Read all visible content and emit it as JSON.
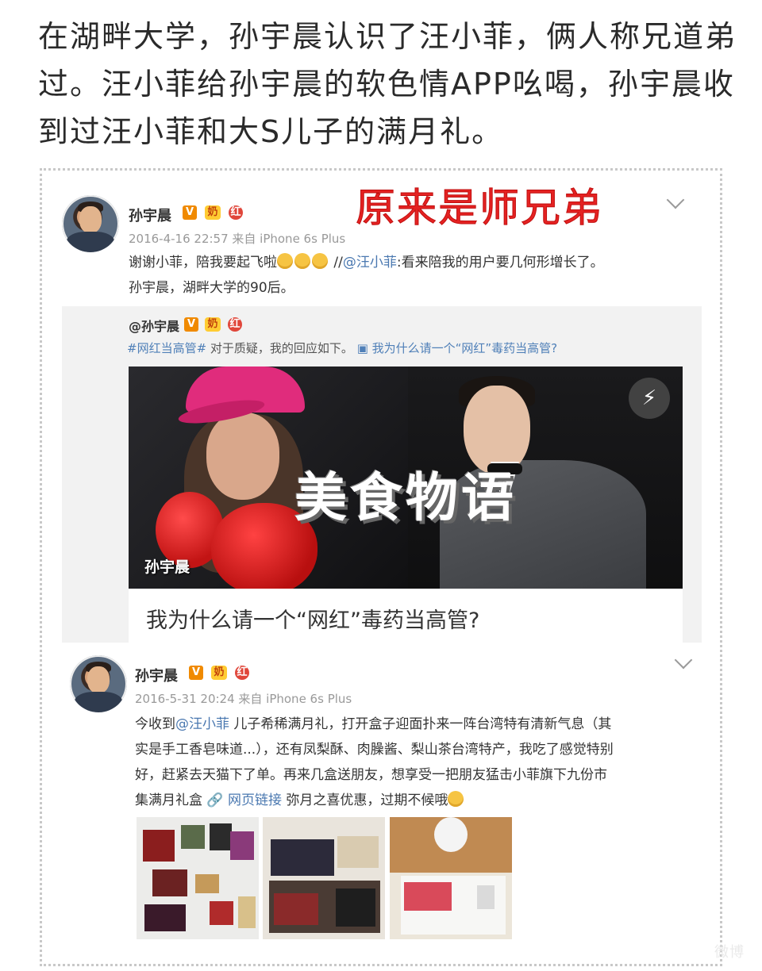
{
  "headline": "在湖畔大学，孙宇晨认识了汪小菲，俩人称兄道弟过。汪小菲给孙宇晨的软色情APP吆喝，孙宇晨收到过汪小菲和大S儿子的满月礼。",
  "overlay_red": "原来是师兄弟",
  "post1": {
    "user": "孙宇晨",
    "badges": [
      "V",
      "奶",
      "红"
    ],
    "meta": "2016-4-16 22:57 来自 iPhone 6s Plus",
    "text_before": "谢谢小菲，陪我要起飞啦",
    "text_after": " //",
    "mention": "@汪小菲",
    "text_rest": ":看来陪我的用户要几何形增长了。",
    "line2": "孙宇晨，湖畔大学的90后。",
    "emoji_count": 3
  },
  "repost": {
    "user": "@孙宇晨",
    "hashtag": "#网红当高管#",
    "text": " 对于质疑，我的回应如下。 ",
    "link": "▣ 我为什么请一个“网红”毒药当高管?",
    "watermark": "美食物语",
    "photo_tag": "孙宇晨",
    "card_title": "我为什么请一个“网红”毒药当高管?"
  },
  "post2": {
    "user": "孙宇晨",
    "meta": "2016-5-31 20:24 来自 iPhone 6s Plus",
    "line1a": "今收到",
    "mention": "@汪小菲",
    "line1b": " 儿子希稀满月礼，打开盒子迎面扑来一阵台湾特有清新气息（其",
    "line2": "实是手工香皂味道...），还有凤梨酥、肉臊酱、梨山茶台湾特产，我吃了感觉特别",
    "line3": "好，赶紧去天猫下了单。再来几盒送朋友，想享受一把朋友猛击小菲旗下九份市",
    "line4a": "集满月礼盒 ",
    "weblink": "🔗 网页链接",
    "line4b": " 弥月之喜优惠，过期不候哦"
  },
  "footer": "微博"
}
